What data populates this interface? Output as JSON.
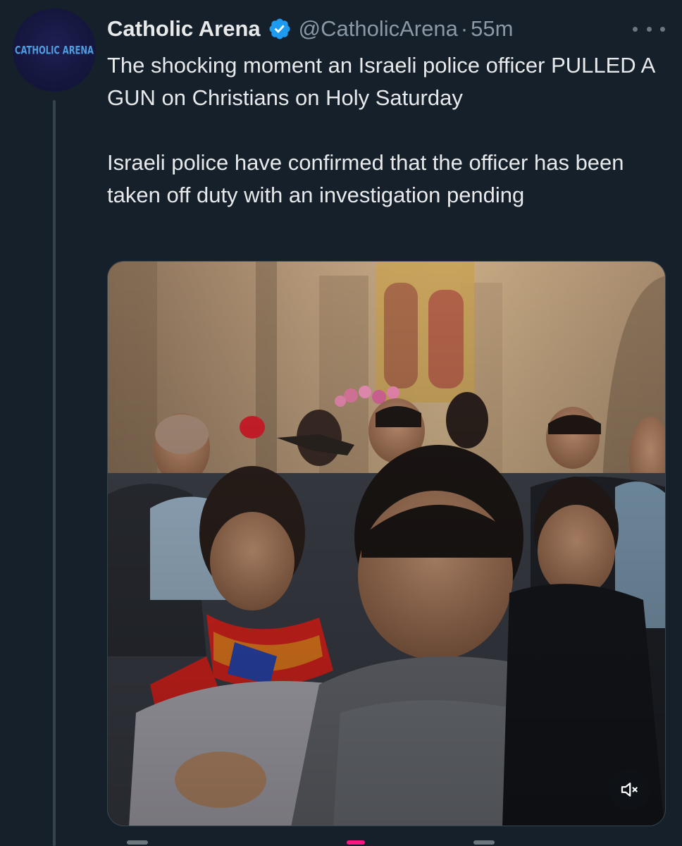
{
  "tweet": {
    "avatar_text": "CATHOLIC ARENA",
    "display_name": "Catholic Arena",
    "verified": true,
    "handle": "@CatholicArena",
    "separator": "·",
    "time": "55m",
    "text_paragraphs": [
      "The shocking moment an Israeli police officer PULLED A GUN on Christians on Holy Saturday",
      "Israeli police have confirmed that the officer has been taken off duty with an investigation pending"
    ]
  },
  "icons": {
    "verified": "verified-badge-icon",
    "more": "more-horizontal-icon",
    "mute": "speaker-muted-icon"
  },
  "colors": {
    "background": "#15202b",
    "text_primary": "#e7e9ea",
    "text_secondary": "#8b98a5",
    "accent": "#1d9bf0",
    "thread_line": "#38444d",
    "avatar_bg": "#1a1c4a",
    "avatar_text": "#4f9ce0"
  }
}
